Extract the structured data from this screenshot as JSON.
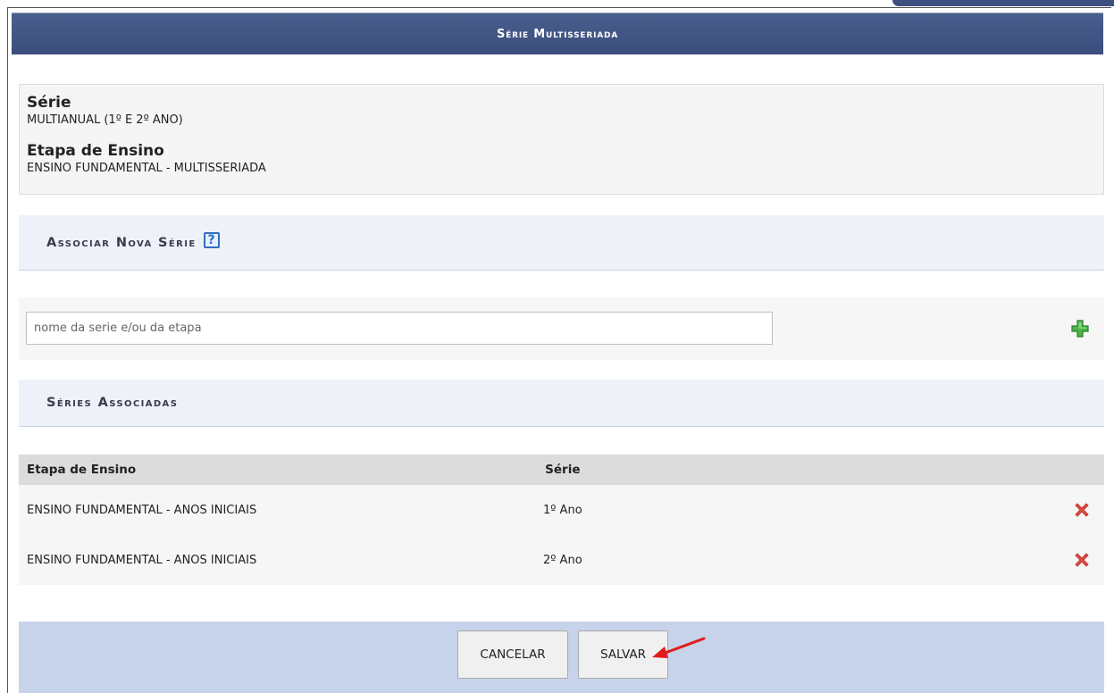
{
  "window": {
    "title": "Série Multisseriada"
  },
  "info": {
    "serie_label": "Série",
    "serie_value": "MULTIANUAL (1º E 2º ANO)",
    "etapa_label": "Etapa de Ensino",
    "etapa_value": "ENSINO FUNDAMENTAL - MULTISSERIADA"
  },
  "associar": {
    "title": "Associar Nova Série",
    "help_icon_glyph": "?",
    "search_placeholder": "nome da serie e/ou da etapa",
    "search_value": "",
    "add_icon": "green-plus-icon"
  },
  "series_associadas": {
    "title": "Séries Associadas",
    "columns": [
      "Etapa de Ensino",
      "Série",
      ""
    ],
    "rows": [
      {
        "etapa": "ENSINO FUNDAMENTAL - ANOS INICIAIS",
        "serie": "1º Ano",
        "action_icon": "red-x-delete-icon"
      },
      {
        "etapa": "ENSINO FUNDAMENTAL - ANOS INICIAIS",
        "serie": "2º Ano",
        "action_icon": "red-x-delete-icon"
      }
    ]
  },
  "footer": {
    "cancel_label": "CANCELAR",
    "save_label": "SALVAR"
  },
  "colors": {
    "title_bar": "#3f5282",
    "section_bg": "#eef2f8",
    "footer_bg": "#c7d3ea",
    "add_green": "#3aa23a",
    "delete_red": "#e0413a",
    "annotation_arrow": "#e11b1b"
  }
}
